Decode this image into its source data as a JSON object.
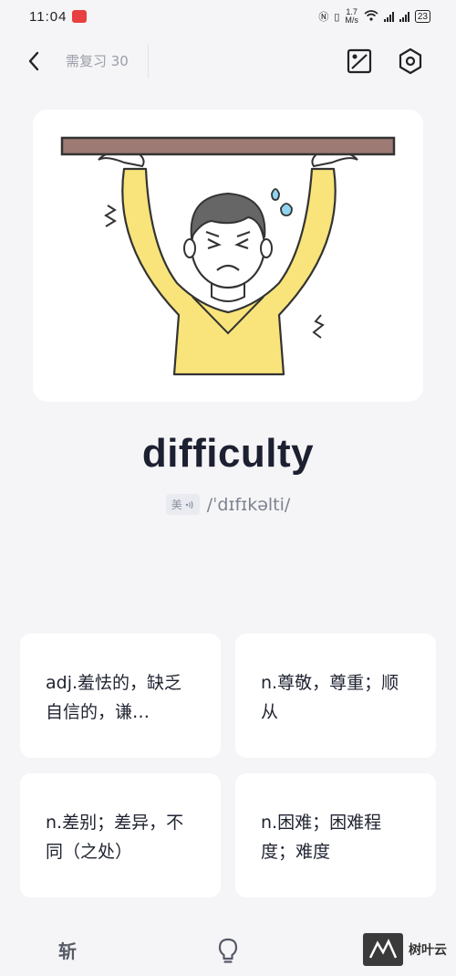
{
  "status_bar": {
    "time": "11:04",
    "speed_value": "1.7",
    "speed_unit": "M/s",
    "battery": "23"
  },
  "header": {
    "review_label": "需复习 30"
  },
  "card": {
    "word": "difficulty",
    "accent": "美",
    "phonetic": "/ˈdɪfɪkəlti/"
  },
  "options": [
    {
      "text": "adj.羞怯的，缺乏自信的，谦…"
    },
    {
      "text": "n.尊敬，尊重；顺从"
    },
    {
      "text": "n.差别；差异，不同（之处）"
    },
    {
      "text": "n.困难；困难程度；难度"
    }
  ],
  "bottom_bar": {
    "cut_label": "斩",
    "watermark": "树叶云"
  },
  "colors": {
    "background": "#f5f5f7",
    "card": "#ffffff",
    "word": "#1c2030",
    "muted": "#9a9ea8",
    "sweater": "#f8e47a"
  }
}
